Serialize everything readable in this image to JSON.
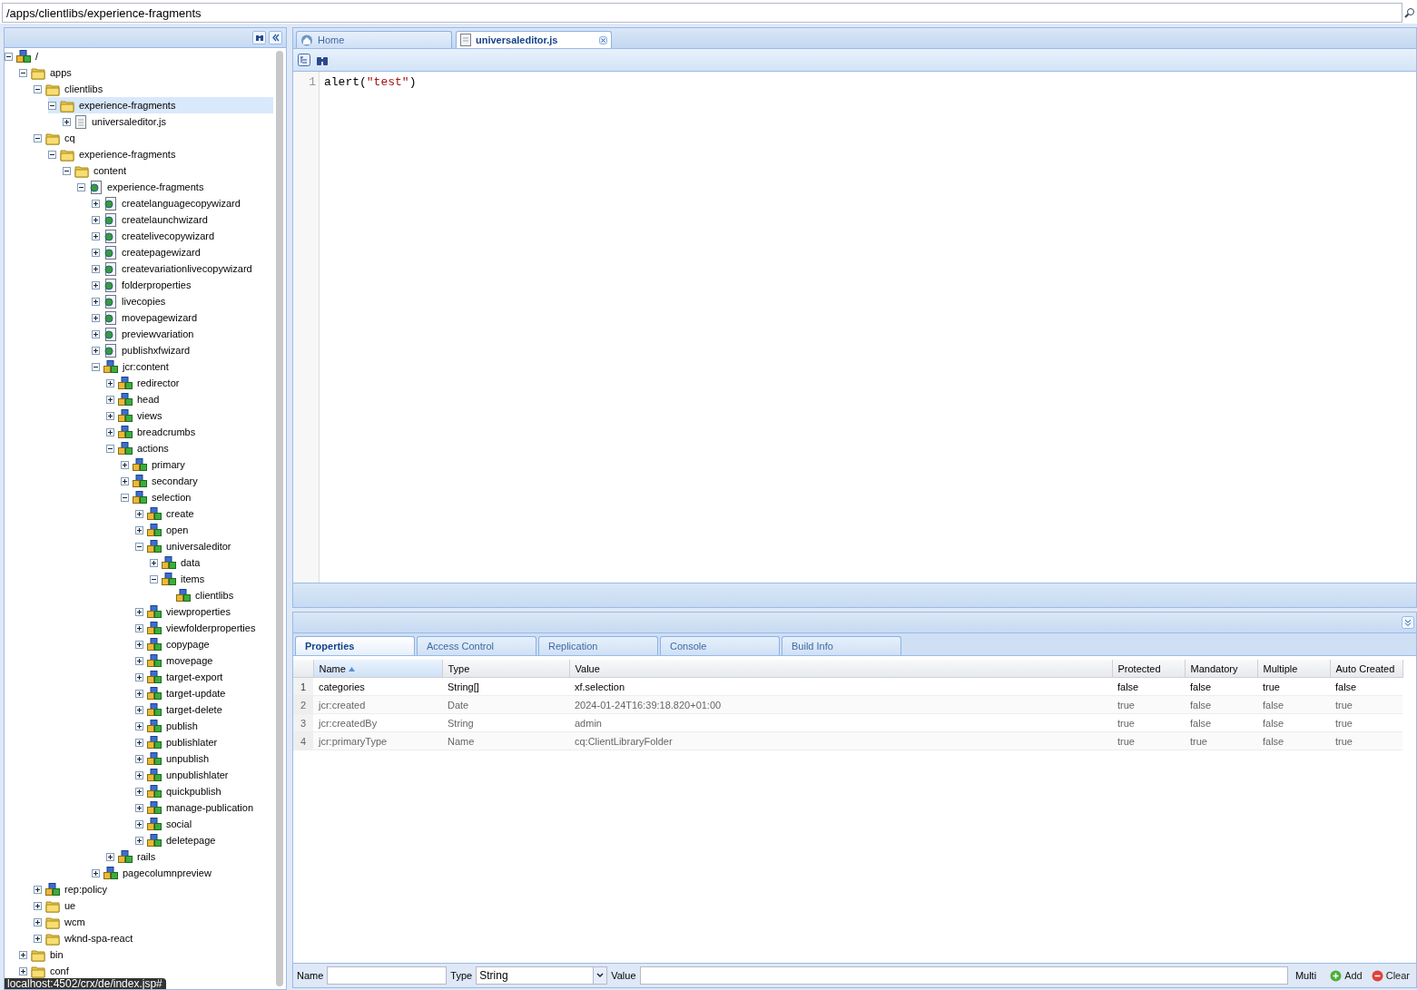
{
  "address_bar": {
    "value": "/apps/clientlibs/experience-fragments"
  },
  "tree": [
    {
      "label": "/",
      "kind": "node",
      "expanded": true,
      "selected": false,
      "children": [
        {
          "label": "apps",
          "kind": "folder",
          "expanded": true,
          "selected": false,
          "children": [
            {
              "label": "clientlibs",
              "kind": "folder",
              "expanded": true,
              "selected": false,
              "children": [
                {
                  "label": "experience-fragments",
                  "kind": "folder",
                  "expanded": true,
                  "selected": true,
                  "children": [
                    {
                      "label": "universaleditor.js",
                      "kind": "file",
                      "expanded": false,
                      "selected": false
                    }
                  ]
                }
              ]
            },
            {
              "label": "cq",
              "kind": "folder",
              "expanded": true,
              "selected": false,
              "children": [
                {
                  "label": "experience-fragments",
                  "kind": "folder",
                  "expanded": true,
                  "selected": false,
                  "children": [
                    {
                      "label": "content",
                      "kind": "folder",
                      "expanded": true,
                      "selected": false,
                      "children": [
                        {
                          "label": "experience-fragments",
                          "kind": "page",
                          "expanded": true,
                          "selected": false,
                          "children": [
                            {
                              "label": "createlanguagecopywizard",
                              "kind": "page",
                              "expanded": false,
                              "selected": false
                            },
                            {
                              "label": "createlaunchwizard",
                              "kind": "page",
                              "expanded": false,
                              "selected": false
                            },
                            {
                              "label": "createlivecopywizard",
                              "kind": "page",
                              "expanded": false,
                              "selected": false
                            },
                            {
                              "label": "createpagewizard",
                              "kind": "page",
                              "expanded": false,
                              "selected": false
                            },
                            {
                              "label": "createvariationlivecopywizard",
                              "kind": "page",
                              "expanded": false,
                              "selected": false
                            },
                            {
                              "label": "folderproperties",
                              "kind": "page",
                              "expanded": false,
                              "selected": false
                            },
                            {
                              "label": "livecopies",
                              "kind": "page",
                              "expanded": false,
                              "selected": false
                            },
                            {
                              "label": "movepagewizard",
                              "kind": "page",
                              "expanded": false,
                              "selected": false
                            },
                            {
                              "label": "previewvariation",
                              "kind": "page",
                              "expanded": false,
                              "selected": false
                            },
                            {
                              "label": "publishxfwizard",
                              "kind": "page",
                              "expanded": false,
                              "selected": false
                            },
                            {
                              "label": "jcr:content",
                              "kind": "node",
                              "expanded": true,
                              "selected": false,
                              "children": [
                                {
                                  "label": "redirector",
                                  "kind": "node",
                                  "expanded": false,
                                  "selected": false
                                },
                                {
                                  "label": "head",
                                  "kind": "node",
                                  "expanded": false,
                                  "selected": false
                                },
                                {
                                  "label": "views",
                                  "kind": "node",
                                  "expanded": false,
                                  "selected": false
                                },
                                {
                                  "label": "breadcrumbs",
                                  "kind": "node",
                                  "expanded": false,
                                  "selected": false
                                },
                                {
                                  "label": "actions",
                                  "kind": "node",
                                  "expanded": true,
                                  "selected": false,
                                  "children": [
                                    {
                                      "label": "primary",
                                      "kind": "node",
                                      "expanded": false,
                                      "selected": false
                                    },
                                    {
                                      "label": "secondary",
                                      "kind": "node",
                                      "expanded": false,
                                      "selected": false
                                    },
                                    {
                                      "label": "selection",
                                      "kind": "node",
                                      "expanded": true,
                                      "selected": false,
                                      "children": [
                                        {
                                          "label": "create",
                                          "kind": "node",
                                          "expanded": false,
                                          "selected": false
                                        },
                                        {
                                          "label": "open",
                                          "kind": "node",
                                          "expanded": false,
                                          "selected": false
                                        },
                                        {
                                          "label": "universaleditor",
                                          "kind": "node",
                                          "expanded": true,
                                          "selected": false,
                                          "children": [
                                            {
                                              "label": "data",
                                              "kind": "node",
                                              "expanded": false,
                                              "selected": false
                                            },
                                            {
                                              "label": "items",
                                              "kind": "node",
                                              "expanded": true,
                                              "selected": false,
                                              "children": [
                                                {
                                                  "label": "clientlibs",
                                                  "kind": "node",
                                                  "selected": false
                                                }
                                              ]
                                            }
                                          ]
                                        },
                                        {
                                          "label": "viewproperties",
                                          "kind": "node",
                                          "expanded": false,
                                          "selected": false
                                        },
                                        {
                                          "label": "viewfolderproperties",
                                          "kind": "node",
                                          "expanded": false,
                                          "selected": false
                                        },
                                        {
                                          "label": "copypage",
                                          "kind": "node",
                                          "expanded": false,
                                          "selected": false
                                        },
                                        {
                                          "label": "movepage",
                                          "kind": "node",
                                          "expanded": false,
                                          "selected": false
                                        },
                                        {
                                          "label": "target-export",
                                          "kind": "node",
                                          "expanded": false,
                                          "selected": false
                                        },
                                        {
                                          "label": "target-update",
                                          "kind": "node",
                                          "expanded": false,
                                          "selected": false
                                        },
                                        {
                                          "label": "target-delete",
                                          "kind": "node",
                                          "expanded": false,
                                          "selected": false
                                        },
                                        {
                                          "label": "publish",
                                          "kind": "node",
                                          "expanded": false,
                                          "selected": false
                                        },
                                        {
                                          "label": "publishlater",
                                          "kind": "node",
                                          "expanded": false,
                                          "selected": false
                                        },
                                        {
                                          "label": "unpublish",
                                          "kind": "node",
                                          "expanded": false,
                                          "selected": false
                                        },
                                        {
                                          "label": "unpublishlater",
                                          "kind": "node",
                                          "expanded": false,
                                          "selected": false
                                        },
                                        {
                                          "label": "quickpublish",
                                          "kind": "node",
                                          "expanded": false,
                                          "selected": false
                                        },
                                        {
                                          "label": "manage-publication",
                                          "kind": "node",
                                          "expanded": false,
                                          "selected": false
                                        },
                                        {
                                          "label": "social",
                                          "kind": "node",
                                          "expanded": false,
                                          "selected": false
                                        },
                                        {
                                          "label": "deletepage",
                                          "kind": "node",
                                          "expanded": false,
                                          "selected": false
                                        }
                                      ]
                                    }
                                  ]
                                },
                                {
                                  "label": "rails",
                                  "kind": "node",
                                  "expanded": false,
                                  "selected": false
                                }
                              ]
                            },
                            {
                              "label": "pagecolumnpreview",
                              "kind": "node",
                              "expanded": false,
                              "selected": false
                            }
                          ]
                        }
                      ]
                    }
                  ]
                }
              ]
            },
            {
              "label": "rep:policy",
              "kind": "node",
              "expanded": false,
              "selected": false
            },
            {
              "label": "ue",
              "kind": "folder",
              "expanded": false,
              "selected": false
            },
            {
              "label": "wcm",
              "kind": "folder",
              "expanded": false,
              "selected": false
            },
            {
              "label": "wknd-spa-react",
              "kind": "folder",
              "expanded": false,
              "selected": false
            }
          ]
        },
        {
          "label": "bin",
          "kind": "folder",
          "expanded": false,
          "selected": false
        },
        {
          "label": "conf",
          "kind": "folder",
          "expanded": false,
          "selected": false
        }
      ]
    }
  ],
  "status_tooltip": "localhost:4502/crx/de/index.jsp#",
  "editor_tabs": [
    {
      "label": "Home",
      "kind": "home",
      "selected": false,
      "closable": false
    },
    {
      "label": "universaleditor.js",
      "kind": "file",
      "selected": true,
      "closable": true
    }
  ],
  "editor": {
    "lines": [
      {
        "number": "1",
        "tokens": [
          {
            "text": "alert(",
            "kind": "plain"
          },
          {
            "text": "\"test\"",
            "kind": "string"
          },
          {
            "text": ")",
            "kind": "plain"
          }
        ]
      }
    ]
  },
  "bottom_tabs": [
    {
      "label": "Properties",
      "selected": true
    },
    {
      "label": "Access Control",
      "selected": false
    },
    {
      "label": "Replication",
      "selected": false
    },
    {
      "label": "Console",
      "selected": false
    },
    {
      "label": "Build Info",
      "selected": false
    }
  ],
  "properties": {
    "columns": [
      {
        "label": "Name",
        "sorted": true
      },
      {
        "label": "Type",
        "sorted": false
      },
      {
        "label": "Value",
        "sorted": false
      },
      {
        "label": "Protected",
        "sorted": false
      },
      {
        "label": "Mandatory",
        "sorted": false
      },
      {
        "label": "Multiple",
        "sorted": false
      },
      {
        "label": "Auto Created",
        "sorted": false
      }
    ],
    "rows": [
      {
        "index": "1",
        "greyed": false,
        "cells": [
          "categories",
          "String[]",
          "xf.selection",
          "false",
          "false",
          "true",
          "false"
        ]
      },
      {
        "index": "2",
        "greyed": true,
        "cells": [
          "jcr:created",
          "Date",
          "2024-01-24T16:39:18.820+01:00",
          "true",
          "false",
          "false",
          "true"
        ]
      },
      {
        "index": "3",
        "greyed": true,
        "cells": [
          "jcr:createdBy",
          "String",
          "admin",
          "true",
          "false",
          "false",
          "true"
        ]
      },
      {
        "index": "4",
        "greyed": true,
        "cells": [
          "jcr:primaryType",
          "Name",
          "cq:ClientLibraryFolder",
          "true",
          "true",
          "false",
          "true"
        ]
      }
    ]
  },
  "property_form": {
    "name_label": "Name",
    "type_label": "Type",
    "type_value": "String",
    "value_label": "Value",
    "multi_label": "Multi",
    "add_button": "Add",
    "clear_button": "Clear"
  }
}
